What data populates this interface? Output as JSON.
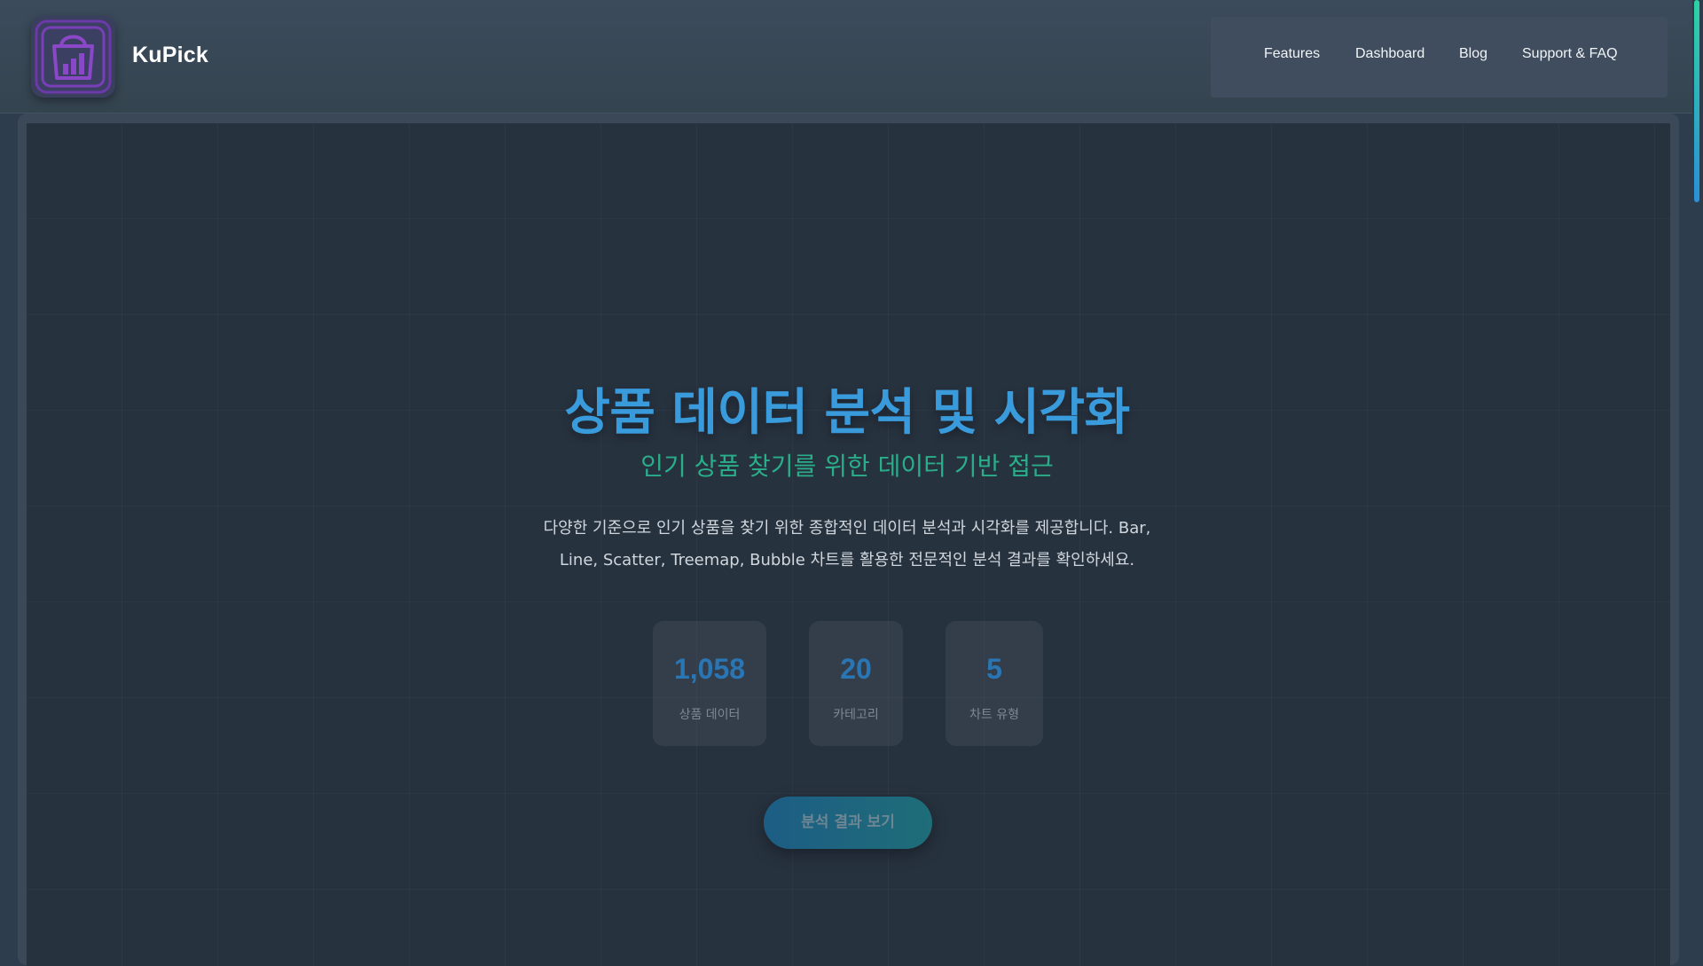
{
  "header": {
    "brand": "KuPick",
    "logo_icon": "shopping-bag-chart-icon",
    "nav": [
      {
        "label": "Features"
      },
      {
        "label": "Dashboard"
      },
      {
        "label": "Blog"
      },
      {
        "label": "Support & FAQ"
      }
    ]
  },
  "hero": {
    "title": "상품 데이터 분석 및 시각화",
    "subtitle": "인기 상품 찾기를 위한 데이터 기반 접근",
    "description_line1": "다양한 기준으로 인기 상품을 찾기 위한 종합적인 데이터 분석과 시각화를 제공합니다. Bar,",
    "description_line2": "Line, Scatter, Treemap, Bubble 차트를 활용한 전문적인 분석 결과를 확인하세요.",
    "stats": [
      {
        "value": "1,058",
        "label": "상품 데이터"
      },
      {
        "value": "20",
        "label": "카테고리"
      },
      {
        "value": "5",
        "label": "차트 유형"
      }
    ],
    "cta_label": "분석 결과 보기"
  },
  "colors": {
    "accent_blue": "#3a9bdc",
    "accent_teal": "#2aae8a",
    "logo_purple": "#7a3fb8",
    "background": "#27323f"
  }
}
